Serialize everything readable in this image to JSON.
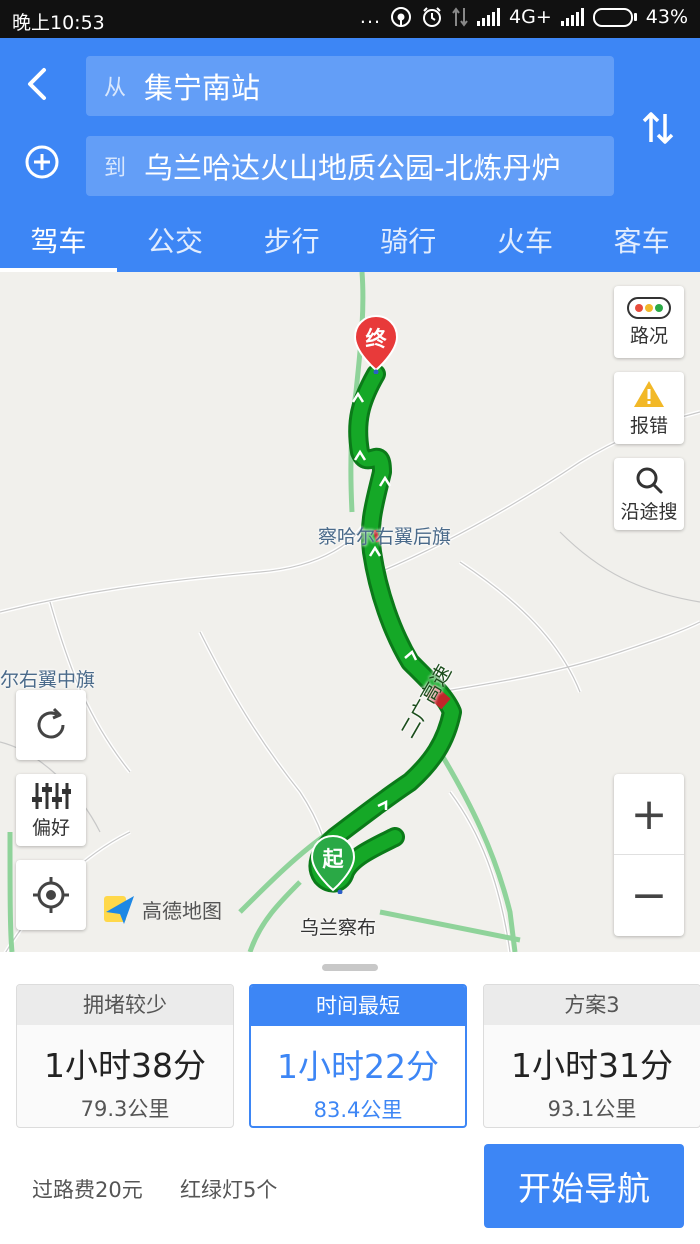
{
  "status_bar": {
    "time": "晚上10:53",
    "dots": "...",
    "network": "4G+",
    "battery": "43%",
    "battery_level": 0.43
  },
  "route": {
    "from_prefix": "从",
    "from": "集宁南站",
    "to_prefix": "到",
    "to": "乌兰哈达火山地质公园-北炼丹炉"
  },
  "tabs": [
    "驾车",
    "公交",
    "步行",
    "骑行",
    "火车",
    "客车"
  ],
  "map": {
    "labels": {
      "town_upper": "察哈尔右翼后旗",
      "town_left": "尔右翼中旗",
      "town_lower": "乌兰察布",
      "road_name": "二广高速"
    },
    "end_marker": "终",
    "start_marker": "起",
    "logo_text": "高德地图",
    "buttons": {
      "traffic": "路况",
      "report": "报错",
      "search_along": "沿途搜",
      "preference": "偏好",
      "zoom_in": "+",
      "zoom_out": "−"
    },
    "colors": {
      "route_green": "#15a827",
      "route_border": "#0b7a19",
      "congestion_red": "#c0262a",
      "pin_red": "#e83a3a",
      "pin_green": "#2aa946"
    }
  },
  "plans": [
    {
      "title": "拥堵较少",
      "duration": "1小时38分",
      "distance": "79.3公里"
    },
    {
      "title": "时间最短",
      "duration": "1小时22分",
      "distance": "83.4公里"
    },
    {
      "title": "方案3",
      "duration": "1小时31分",
      "distance": "93.1公里"
    }
  ],
  "footer": {
    "toll": "过路费20元",
    "lights": "红绿灯5个",
    "start_nav": "开始导航"
  },
  "accent_color": "#3d86f5"
}
